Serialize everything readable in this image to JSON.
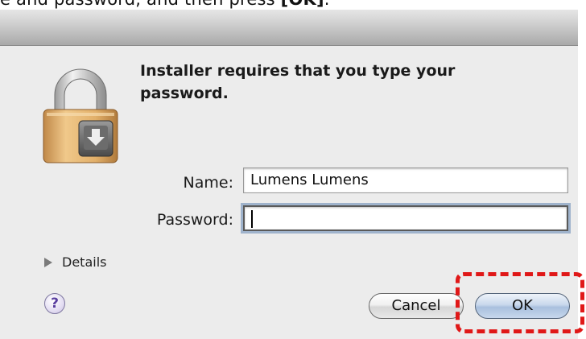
{
  "caption": {
    "prefix": "e and password, and then press ",
    "bold": "[OK]",
    "suffix": "."
  },
  "dialog": {
    "message": "Installer requires that you type your password.",
    "name_label": "Name:",
    "name_value": "Lumens Lumens",
    "password_label": "Password:",
    "password_value": "",
    "details_label": "Details",
    "help_label": "?",
    "cancel_label": "Cancel",
    "ok_label": "OK"
  },
  "icons": {
    "lock": "padlock-icon",
    "disclosure": "disclosure-triangle-icon",
    "help": "help-icon"
  },
  "colors": {
    "highlight": "#e01818",
    "default_button": "#a9c0de",
    "dialog_bg": "#ececec"
  }
}
